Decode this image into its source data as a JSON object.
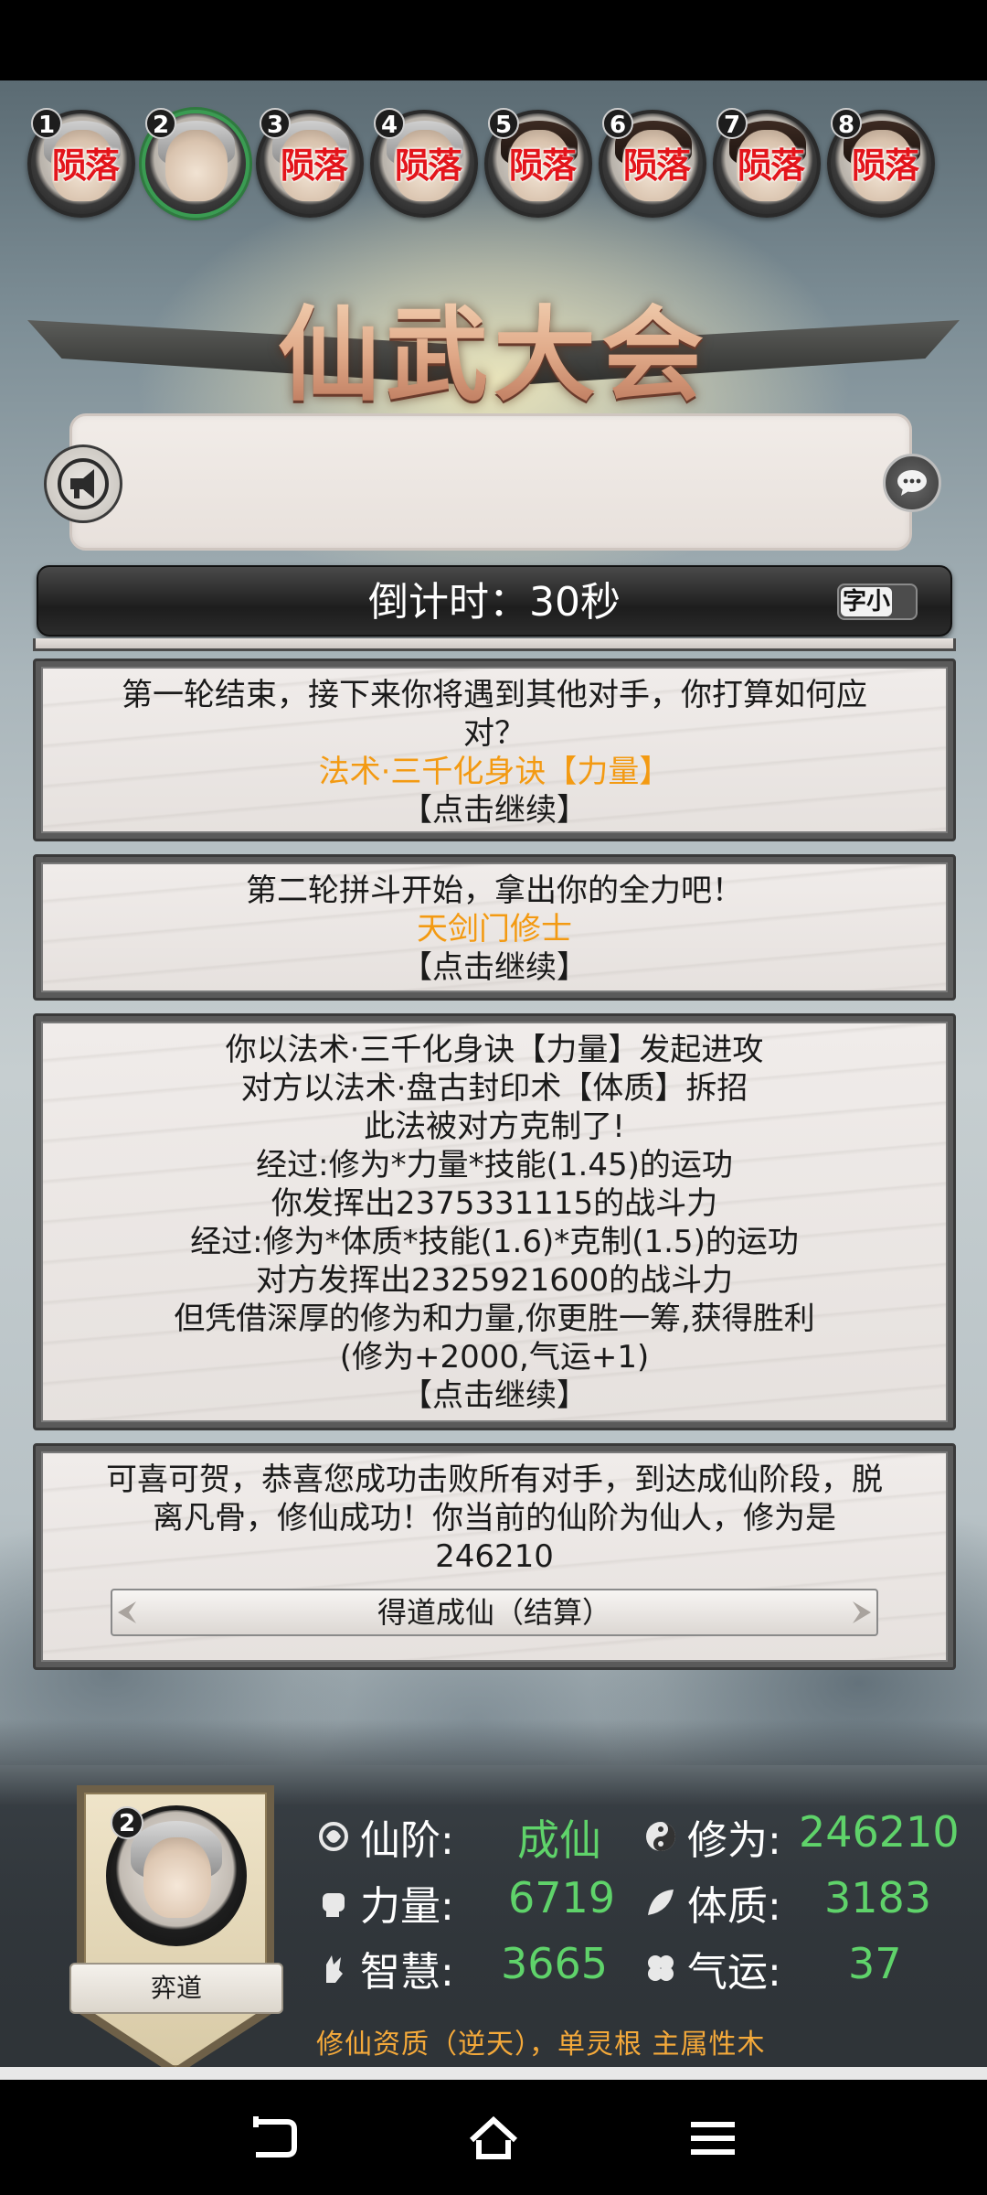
{
  "players": [
    {
      "number": "1",
      "status": "陨落"
    },
    {
      "number": "2",
      "status": ""
    },
    {
      "number": "3",
      "status": "陨落"
    },
    {
      "number": "4",
      "status": "陨落"
    },
    {
      "number": "5",
      "status": "陨落"
    },
    {
      "number": "6",
      "status": "陨落"
    },
    {
      "number": "7",
      "status": "陨落"
    },
    {
      "number": "8",
      "status": "陨落"
    }
  ],
  "title": "仙武大会",
  "countdown": {
    "text": "倒计时：30秒"
  },
  "font_toggle": {
    "label": "字小"
  },
  "log": [
    {
      "lines": [
        "第一轮结束，接下来你将遇到其他对手，你打算如何应",
        "对？"
      ],
      "highlight": "法术·三千化身诀【力量】",
      "continue": "【点击继续】"
    },
    {
      "lines": [
        "第二轮拼斗开始，拿出你的全力吧！"
      ],
      "highlight": "天剑门修士",
      "continue": "【点击继续】"
    },
    {
      "lines": [
        "你以法术·三千化身诀【力量】发起进攻",
        "对方以法术·盘古封印术【体质】拆招",
        "此法被对方克制了!",
        "经过:修为*力量*技能(1.45)的运功",
        "你发挥出2375331115的战斗力",
        "经过:修为*体质*技能(1.6)*克制(1.5)的运功",
        "对方发挥出2325921600的战斗力",
        "但凭借深厚的修为和力量,你更胜一筹,获得胜利",
        "(修为+2000,气运+1)"
      ],
      "continue": "【点击继续】"
    },
    {
      "lines": [
        "可喜可贺，恭喜您成功击败所有对手，到达成仙阶段，脱",
        "离凡骨，修仙成功！你当前的仙阶为仙人，修为是",
        "246210"
      ],
      "button": "得道成仙（结算）"
    }
  ],
  "character": {
    "number": "2",
    "name": "弈道",
    "stats": {
      "rank_label": "仙阶:",
      "rank_value": "成仙",
      "cultivation_label": "修为:",
      "cultivation_value": "246210",
      "strength_label": "力量:",
      "strength_value": "6719",
      "physique_label": "体质:",
      "physique_value": "3183",
      "wisdom_label": "智慧:",
      "wisdom_value": "3665",
      "luck_label": "气运:",
      "luck_value": "37"
    },
    "talent": "修仙资质（逆天），单灵根 主属性木"
  },
  "icons": {
    "broadcast": "megaphone-icon",
    "chat": "chat-bubble-icon",
    "back": "back-icon",
    "home": "home-icon",
    "menu": "menu-icon"
  },
  "colors": {
    "dead": "#e3151b",
    "highlight": "#f39a12",
    "stat_value": "#5fd36a",
    "talent": "#f4a93a"
  }
}
